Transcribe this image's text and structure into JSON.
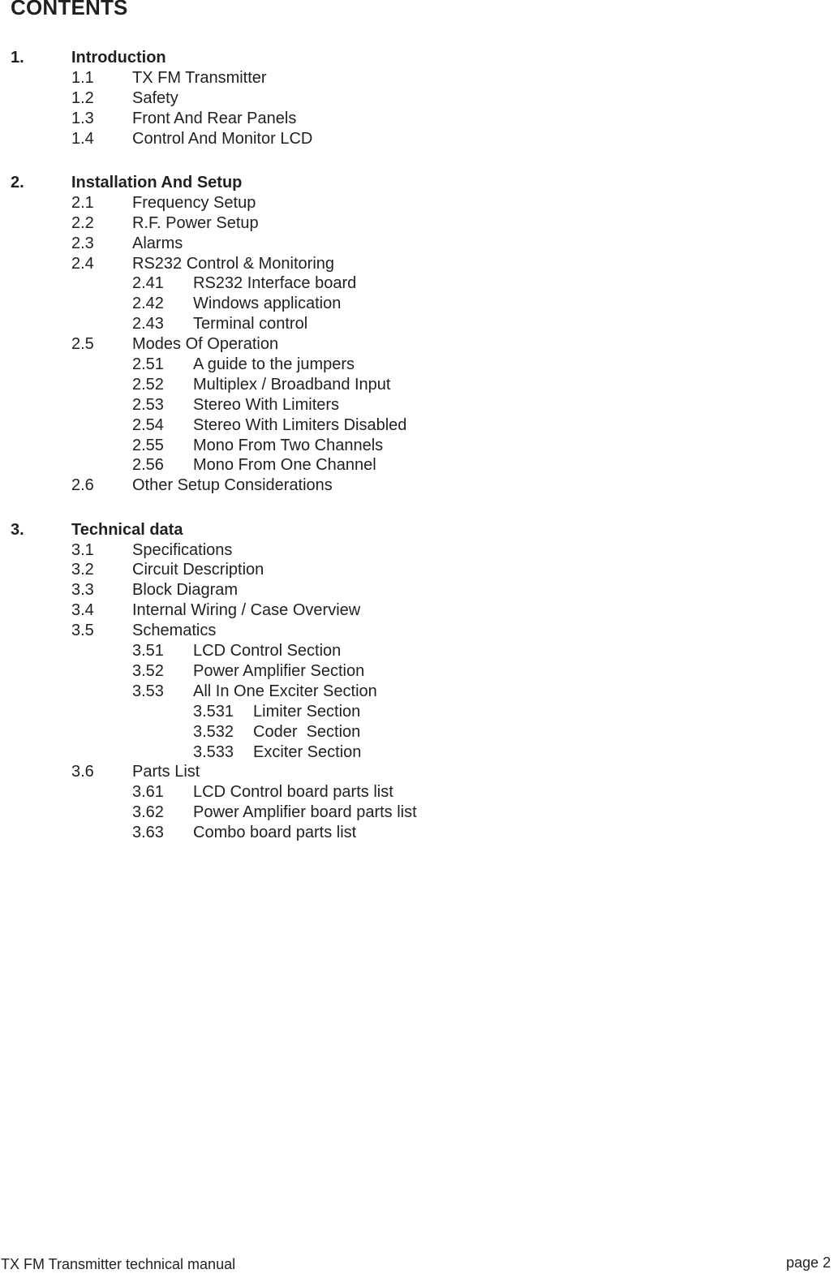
{
  "title": "CONTENTS",
  "sections": [
    {
      "num": "1.",
      "label": "Introduction",
      "items": [
        {
          "num": "1.1",
          "label": "TX FM Transmitter",
          "level": 1
        },
        {
          "num": "1.2",
          "label": "Safety",
          "level": 1
        },
        {
          "num": "1.3",
          "label": "Front And Rear Panels",
          "level": 1
        },
        {
          "num": "1.4",
          "label": "Control And Monitor LCD",
          "level": 1
        }
      ]
    },
    {
      "num": "2.",
      "label": "Installation And Setup",
      "items": [
        {
          "num": "2.1",
          "label": "Frequency Setup",
          "level": 1
        },
        {
          "num": "2.2",
          "label": "R.F. Power Setup",
          "level": 1
        },
        {
          "num": "2.3",
          "label": "Alarms",
          "level": 1
        },
        {
          "num": "2.4",
          "label": "RS232 Control & Monitoring",
          "level": 1
        },
        {
          "num": "2.41",
          "label": "RS232 Interface board",
          "level": 2
        },
        {
          "num": "2.42",
          "label": "Windows application",
          "level": 2
        },
        {
          "num": "2.43",
          "label": "Terminal control",
          "level": 2
        },
        {
          "num": "2.5",
          "label": "Modes Of Operation",
          "level": 1
        },
        {
          "num": "2.51",
          "label": "A guide to the jumpers",
          "level": 2
        },
        {
          "num": "2.52",
          "label": "Multiplex / Broadband Input",
          "level": 2
        },
        {
          "num": "2.53",
          "label": "Stereo With Limiters",
          "level": 2
        },
        {
          "num": "2.54",
          "label": "Stereo With Limiters Disabled",
          "level": 2
        },
        {
          "num": "2.55",
          "label": "Mono From Two Channels",
          "level": 2
        },
        {
          "num": "2.56",
          "label": "Mono From One Channel",
          "level": 2
        },
        {
          "num": "2.6",
          "label": "Other Setup Considerations",
          "level": 1
        }
      ]
    },
    {
      "num": "3.",
      "label": "Technical data",
      "items": [
        {
          "num": "3.1",
          "label": "Specifications",
          "level": 1
        },
        {
          "num": "3.2",
          "label": "Circuit Description",
          "level": 1
        },
        {
          "num": "3.3",
          "label": "Block Diagram",
          "level": 1
        },
        {
          "num": "3.4",
          "label": "Internal Wiring / Case Overview",
          "level": 1
        },
        {
          "num": "3.5",
          "label": "Schematics",
          "level": 1
        },
        {
          "num": "3.51",
          "label": "LCD Control Section",
          "level": 2
        },
        {
          "num": "3.52",
          "label": "Power Amplifier Section",
          "level": 2
        },
        {
          "num": "3.53",
          "label": "All In One Exciter Section",
          "level": 2
        },
        {
          "num": "3.531",
          "label": "Limiter Section",
          "level": 3
        },
        {
          "num": "3.532",
          "label": "Coder  Section",
          "level": 3
        },
        {
          "num": "3.533",
          "label": "Exciter Section",
          "level": 3
        },
        {
          "num": "3.6",
          "label": "Parts List",
          "level": 1
        },
        {
          "num": "3.61",
          "label": "LCD Control board parts list",
          "level": 2
        },
        {
          "num": "3.62",
          "label": "Power Amplifier board parts list",
          "level": 2
        },
        {
          "num": "3.63",
          "label": "Combo board parts list",
          "level": 2
        }
      ]
    }
  ],
  "footer": {
    "left": "TX FM Transmitter technical manual",
    "right": "page 2"
  }
}
